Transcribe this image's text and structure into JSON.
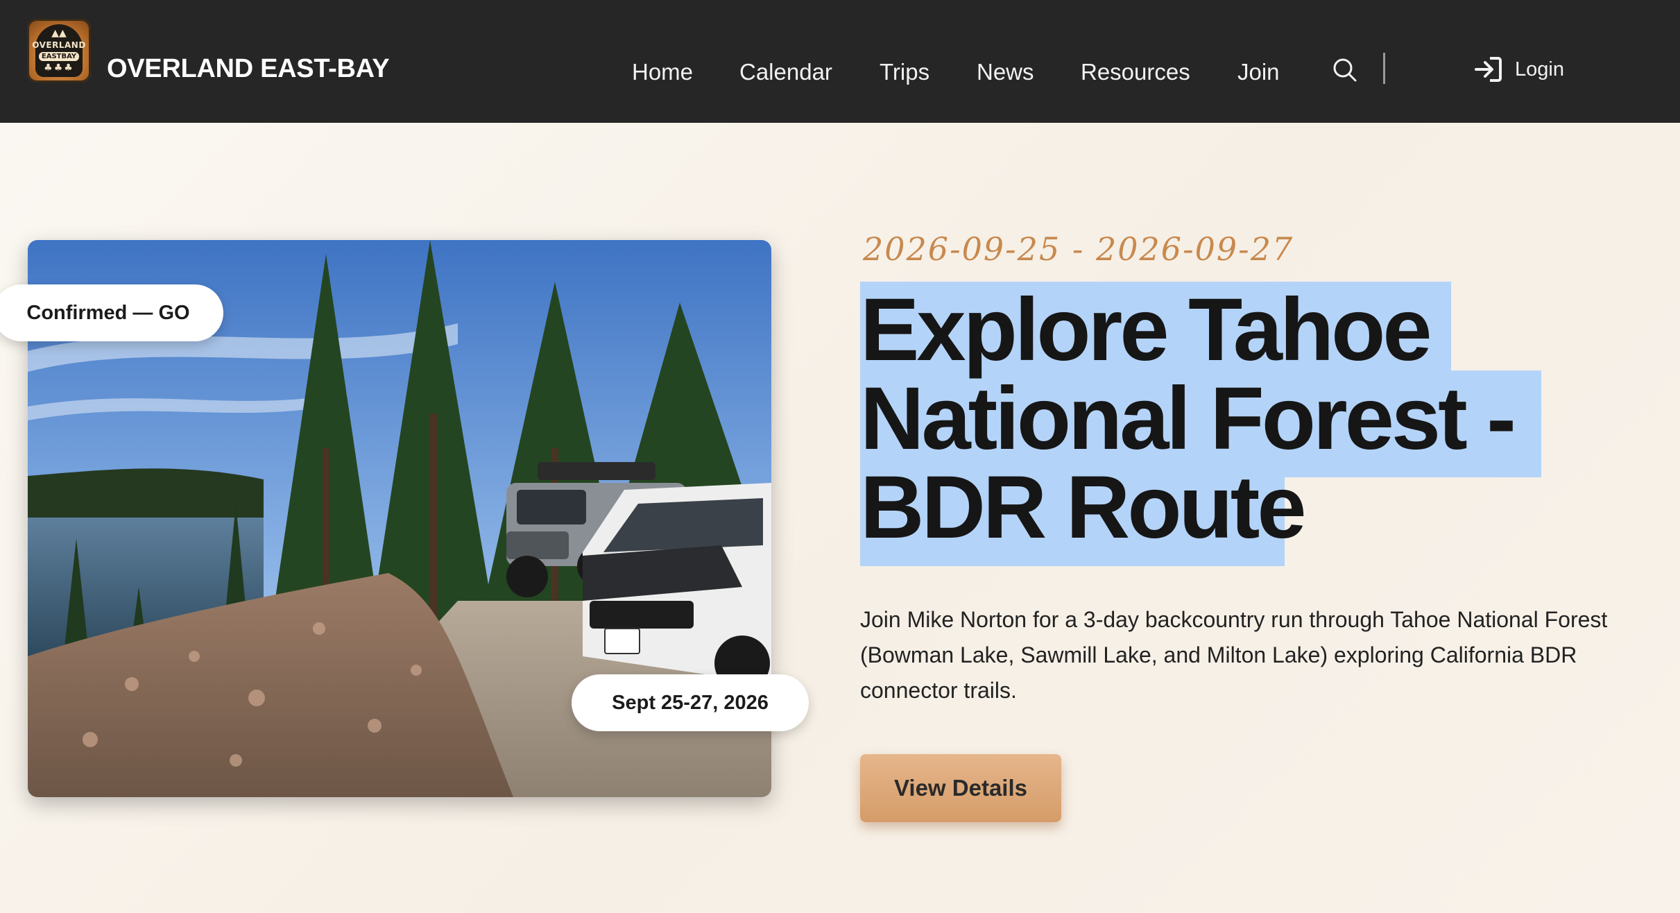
{
  "header": {
    "brand": "OVERLAND EAST-BAY",
    "logo_text": [
      "OVERLAND",
      "EASTBAY"
    ],
    "nav": [
      "Home",
      "Calendar",
      "Trips",
      "News",
      "Resources",
      "Join"
    ],
    "login_label": "Login",
    "background_color": "#262626"
  },
  "hero": {
    "status_badge": "Confirmed — GO",
    "date_badge": "Sept 25-27, 2026",
    "date_range": "2026-09-25 - 2026-09-27",
    "title_lines": [
      "Explore Tahoe",
      "National Forest -",
      "BDR Route"
    ],
    "description": "Join Mike Norton for a 3-day backcountry run through Tahoe National Forest (Bowman Lake, Sawmill Lake, and Milton Lake) exploring California BDR connector trails.",
    "button_label": "View Details",
    "accent_color": "#c8894e",
    "selection_color": "#b4d3f8"
  }
}
